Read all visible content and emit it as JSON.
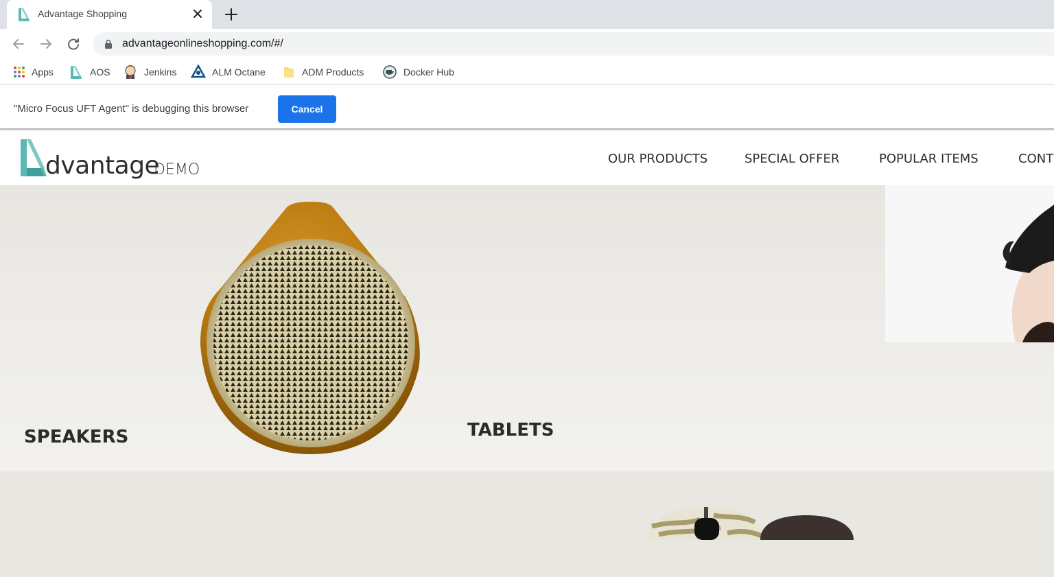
{
  "browser": {
    "tab": {
      "title": "Advantage Shopping"
    },
    "address_bar": {
      "url": "advantageonlineshopping.com/#/"
    },
    "bookmarks": [
      {
        "label": "Apps",
        "icon": "apps-grid-icon"
      },
      {
        "label": "AOS",
        "icon": "aos-logo-icon"
      },
      {
        "label": "Jenkins",
        "icon": "jenkins-icon"
      },
      {
        "label": "ALM Octane",
        "icon": "alm-octane-icon"
      },
      {
        "label": "ADM Products",
        "icon": "folder-icon"
      },
      {
        "label": "Docker Hub",
        "icon": "docker-hub-icon"
      }
    ]
  },
  "infobar": {
    "message": "\"Micro Focus UFT Agent\" is debugging this browser",
    "cancel_label": "Cancel"
  },
  "site": {
    "logo": {
      "word": "dvantage",
      "suffix": "DEMO"
    },
    "nav": [
      "OUR PRODUCTS",
      "SPECIAL OFFER",
      "POPULAR ITEMS",
      "CONT"
    ],
    "categories": {
      "speakers": "SPEAKERS",
      "tablets": "TABLETS"
    }
  },
  "colors": {
    "brand_teal": "#5cb8b2",
    "primary_blue": "#1a73e8",
    "speaker_gold": "#b8790f"
  }
}
